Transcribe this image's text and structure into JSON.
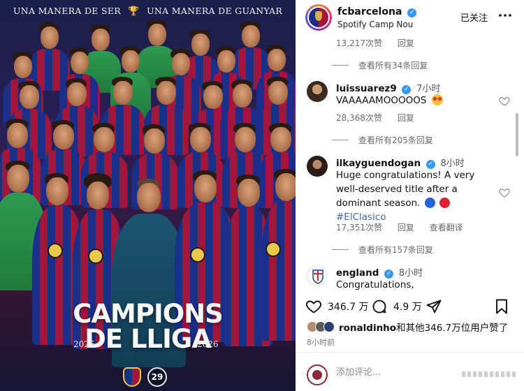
{
  "poster": {
    "tagline_left": "UNA MANERA DE SER",
    "tagline_right": "UNA MANERA DE GUANYAR",
    "title_line1": "CAMPIONS",
    "title_line2": "DE LLIGA",
    "year_left": "2025",
    "year_right": "2026",
    "badge_number": "29"
  },
  "header": {
    "username": "fcbarcelona",
    "location": "Spotify Camp Nou",
    "follow_label": "已关注"
  },
  "thread": {
    "top_meta": {
      "likes": "13,217次赞",
      "reply": "回复"
    },
    "top_view_replies": "查看所有34条回复",
    "comments": [
      {
        "user": "luissuarez9",
        "time": "7小时",
        "text": "VAAAAAMOOOOOS",
        "likes": "28,368次赞",
        "reply": "回复",
        "view_replies": "查看所有205条回复"
      },
      {
        "user": "ilkayguendogan",
        "time": "8小时",
        "text_line1": "Huge congratulations! A very",
        "text_line2": "well-deserved title after a",
        "text_line3": "dominant season.",
        "hashtag": "#ElClasico",
        "likes": "17,351次赞",
        "reply": "回复",
        "translate": "查看翻译",
        "view_replies": "查看所有157条回复"
      },
      {
        "user": "england",
        "time": "8小时",
        "text": "Congratulations,"
      }
    ]
  },
  "actions": {
    "likes": "346.7 万",
    "comments": "4.9 万"
  },
  "liked_by": {
    "name": "ronaldinho",
    "rest": "和其他346.7万位用户赞了"
  },
  "time_ago": "8小时前",
  "composer": {
    "placeholder": "添加评论..."
  },
  "colors": {
    "blaugrana_blue": "#1b2f8a",
    "blaugrana_red": "#a3153c",
    "link": "#3a6ea8",
    "verified": "#3897f0"
  }
}
